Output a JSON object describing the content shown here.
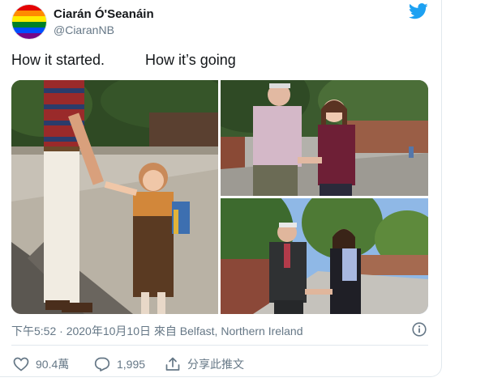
{
  "tweet": {
    "display_name": "Ciarán Ó'Seanáin",
    "handle": "@CiaranNB",
    "text": "How it started.          How it’s going",
    "meta": "下午5:52 · 2020年10月10日 來自 Belfast, Northern Ireland"
  },
  "actions": {
    "like_count": "90.4萬",
    "reply_count": "1,995",
    "share_label": "分享此推文"
  },
  "colors": {
    "twitter_blue": "#1da1f2",
    "secondary_text": "#657786",
    "divider": "#e1e8ed"
  },
  "icons": [
    "avatar-pride-flag",
    "twitter-bird-icon",
    "info-icon",
    "heart-icon",
    "reply-bubble-icon",
    "share-icon"
  ]
}
